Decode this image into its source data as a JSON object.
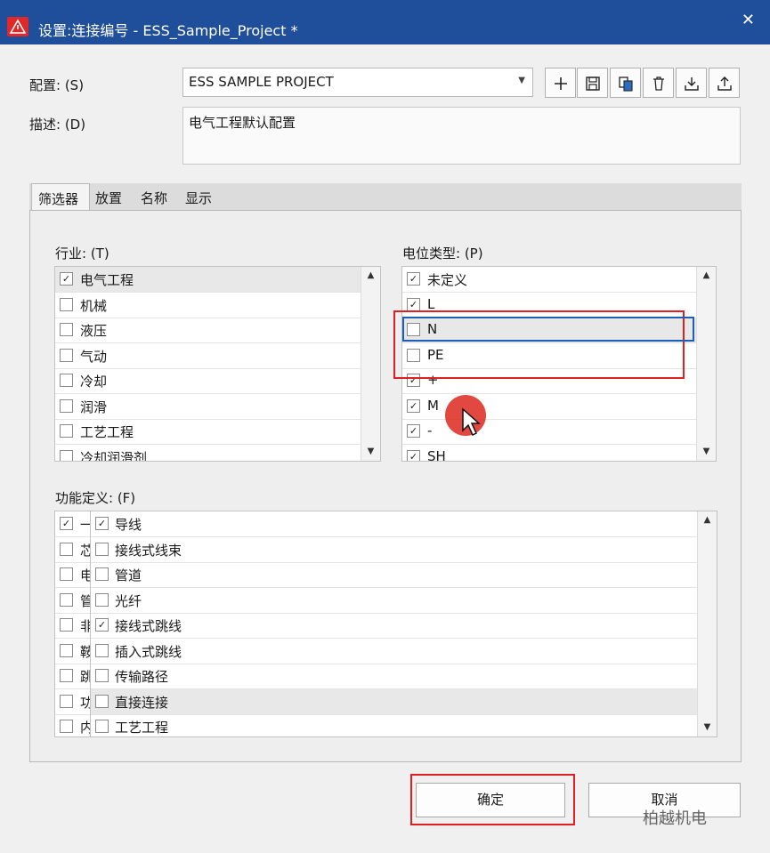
{
  "window": {
    "title": "设置:连接编号 - ESS_Sample_Project *",
    "close_glyph": "✕"
  },
  "config": {
    "label": "配置: (S)",
    "value": "ESS SAMPLE PROJECT"
  },
  "description": {
    "label": "描述: (D)",
    "value": "电气工程默认配置"
  },
  "toolbar": {
    "icons": [
      "plus-icon",
      "save-icon",
      "copy-icon",
      "delete-icon",
      "import-icon",
      "export-icon"
    ]
  },
  "tabs": [
    {
      "label": "筛选器",
      "active": true
    },
    {
      "label": "放置"
    },
    {
      "label": "名称"
    },
    {
      "label": "显示"
    }
  ],
  "industry": {
    "label": "行业: (T)",
    "items": [
      {
        "text": "电气工程",
        "checked": true,
        "selected": true
      },
      {
        "text": "机械",
        "checked": false
      },
      {
        "text": "液压",
        "checked": false
      },
      {
        "text": "气动",
        "checked": false
      },
      {
        "text": "冷却",
        "checked": false
      },
      {
        "text": "润滑",
        "checked": false
      },
      {
        "text": "工艺工程",
        "checked": false
      },
      {
        "text": "冷却润滑剂",
        "checked": false
      }
    ]
  },
  "potential": {
    "label": "电位类型: (P)",
    "items": [
      {
        "text": "未定义",
        "checked": true
      },
      {
        "text": "L",
        "checked": true
      },
      {
        "text": "N",
        "checked": false,
        "selected": true
      },
      {
        "text": "PE",
        "checked": false
      },
      {
        "text": "+",
        "checked": true
      },
      {
        "text": "M",
        "checked": true
      },
      {
        "text": "-",
        "checked": true
      },
      {
        "text": "SH",
        "checked": true
      }
    ]
  },
  "function_def": {
    "label": "功能定义: (F)",
    "back_items": [
      {
        "text": "一",
        "checked": true
      },
      {
        "text": "芯",
        "checked": false
      },
      {
        "text": "电",
        "checked": false
      },
      {
        "text": "管",
        "checked": false
      },
      {
        "text": "非",
        "checked": false
      },
      {
        "text": "鞍",
        "checked": false
      },
      {
        "text": "跳",
        "checked": false
      },
      {
        "text": "功",
        "checked": false
      },
      {
        "text": "内",
        "checked": false
      }
    ],
    "items": [
      {
        "text": "导线",
        "checked": true
      },
      {
        "text": "接线式线束",
        "checked": false
      },
      {
        "text": "管道",
        "checked": false
      },
      {
        "text": "光纤",
        "checked": false
      },
      {
        "text": "接线式跳线",
        "checked": true
      },
      {
        "text": "插入式跳线",
        "checked": false
      },
      {
        "text": "传输路径",
        "checked": false
      },
      {
        "text": "直接连接",
        "checked": false,
        "selected": true
      },
      {
        "text": "工艺工程",
        "checked": false
      }
    ]
  },
  "buttons": {
    "ok": "确定",
    "cancel": "取消"
  },
  "watermark": "柏越机电",
  "colors": {
    "titlebar": "#1f4e9a",
    "highlight_red": "#e02020",
    "highlight_blue": "#1b5fb8"
  }
}
